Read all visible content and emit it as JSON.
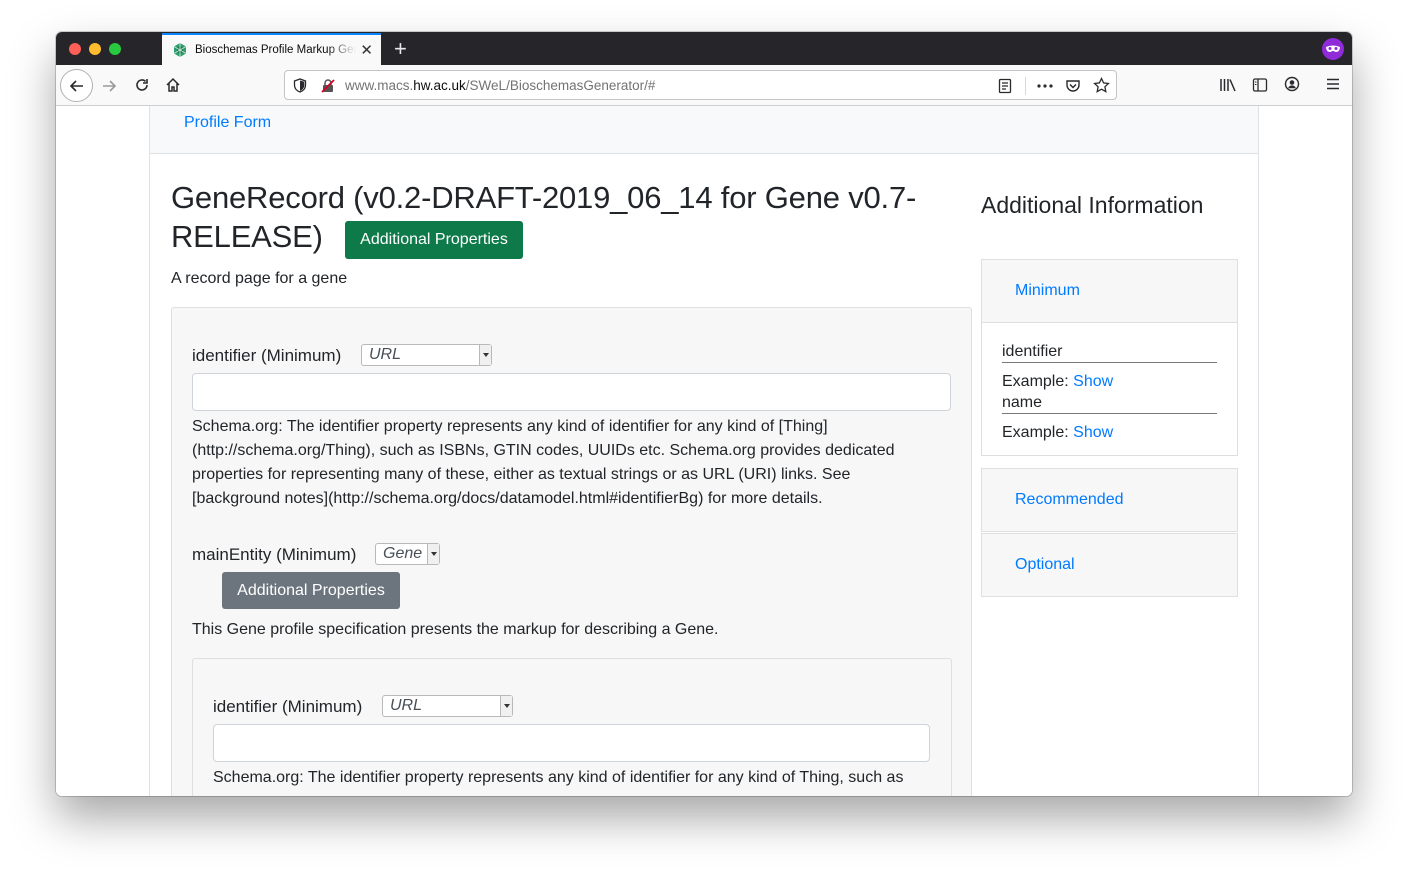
{
  "browser": {
    "tab_title": "Bioschemas Profile Markup Generator",
    "url_prefix": "www.macs.",
    "url_host": "hw.ac.uk",
    "url_path": "/SWeL/BioschemasGenerator/#",
    "colors": {
      "tabbar": "#26262a",
      "accent": "#0a84ff",
      "private": "#8f2bd9"
    }
  },
  "nav": {
    "profile_form": "Profile Form"
  },
  "main": {
    "title": "GeneRecord (v0.2-DRAFT-2019_06_14 for Gene v0.7-RELEASE)",
    "additional_properties": "Additional Properties",
    "lead": "A record page for a gene",
    "fields": [
      {
        "label": "identifier (Minimum)",
        "type": "URL",
        "value": "",
        "description": "Schema.org: The identifier property represents any kind of identifier for any kind of [Thing](http://schema.org/Thing), such as ISBNs, GTIN codes, UUIDs etc. Schema.org provides dedicated properties for representing many of these, either as textual strings or as URL (URI) links. See [background notes](http://schema.org/docs/datamodel.html#identifierBg) for more details."
      },
      {
        "label": "mainEntity (Minimum)",
        "type": "Gene",
        "button": "Additional Properties",
        "description": "This Gene profile specification presents the markup for describing a Gene."
      }
    ],
    "nested_field": {
      "label": "identifier (Minimum)",
      "type": "URL",
      "value": "",
      "description": "Schema.org: The identifier property represents any kind of identifier for any kind of Thing, such as"
    }
  },
  "sidebar": {
    "title": "Additional Information",
    "sections": [
      {
        "label": "Minimum",
        "properties": [
          {
            "name": "identifier",
            "example_label": "Example:",
            "example_link": "Show"
          },
          {
            "name": "name",
            "example_label": "Example:",
            "example_link": "Show"
          }
        ]
      },
      {
        "label": "Recommended"
      },
      {
        "label": "Optional"
      }
    ]
  }
}
